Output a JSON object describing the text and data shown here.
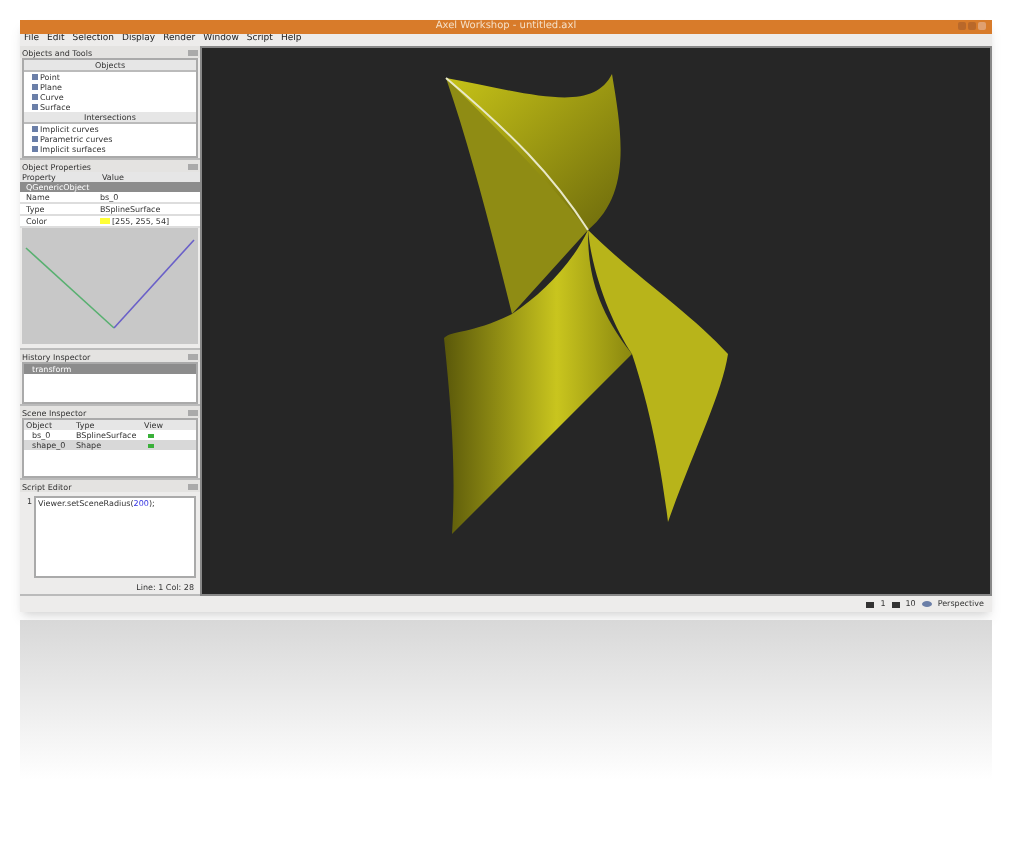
{
  "window": {
    "title": "Axel Workshop - untitled.axl"
  },
  "menu": [
    "File",
    "Edit",
    "Selection",
    "Display",
    "Render",
    "Window",
    "Script",
    "Help"
  ],
  "objects_panel": {
    "title": "Objects and Tools",
    "groups": [
      {
        "label": "Objects",
        "items": [
          "Point",
          "Plane",
          "Curve",
          "Surface"
        ]
      },
      {
        "label": "Intersections",
        "items": [
          "Implicit curves",
          "Parametric curves",
          "Implicit surfaces"
        ]
      }
    ]
  },
  "properties_panel": {
    "title": "Object Properties",
    "columns": [
      "Property",
      "Value"
    ],
    "group": "QGenericObject",
    "rows": [
      {
        "property": "Name",
        "value": "bs_0"
      },
      {
        "property": "Type",
        "value": "BSplineSurface"
      },
      {
        "property": "Color",
        "value": "[255, 255, 54]",
        "color": "#ffff36"
      }
    ]
  },
  "history_panel": {
    "title": "History Inspector",
    "items": [
      {
        "label": "transform",
        "selected": true
      }
    ]
  },
  "scene_panel": {
    "title": "Scene Inspector",
    "columns": [
      "Object",
      "Type",
      "View"
    ],
    "rows": [
      {
        "object": "bs_0",
        "type": "BSplineSurface",
        "visible": true,
        "selected": false
      },
      {
        "object": "shape_0",
        "type": "Shape",
        "visible": true,
        "selected": true
      }
    ]
  },
  "script_panel": {
    "title": "Script Editor",
    "line_number": "1",
    "code": "Viewer.setSceneRadius(",
    "code_number": "200",
    "code_end": ");",
    "position": "Line: 1 Col: 28"
  },
  "status_bar": {
    "count_a": "1",
    "count_b": "10",
    "projection": "Perspective"
  }
}
